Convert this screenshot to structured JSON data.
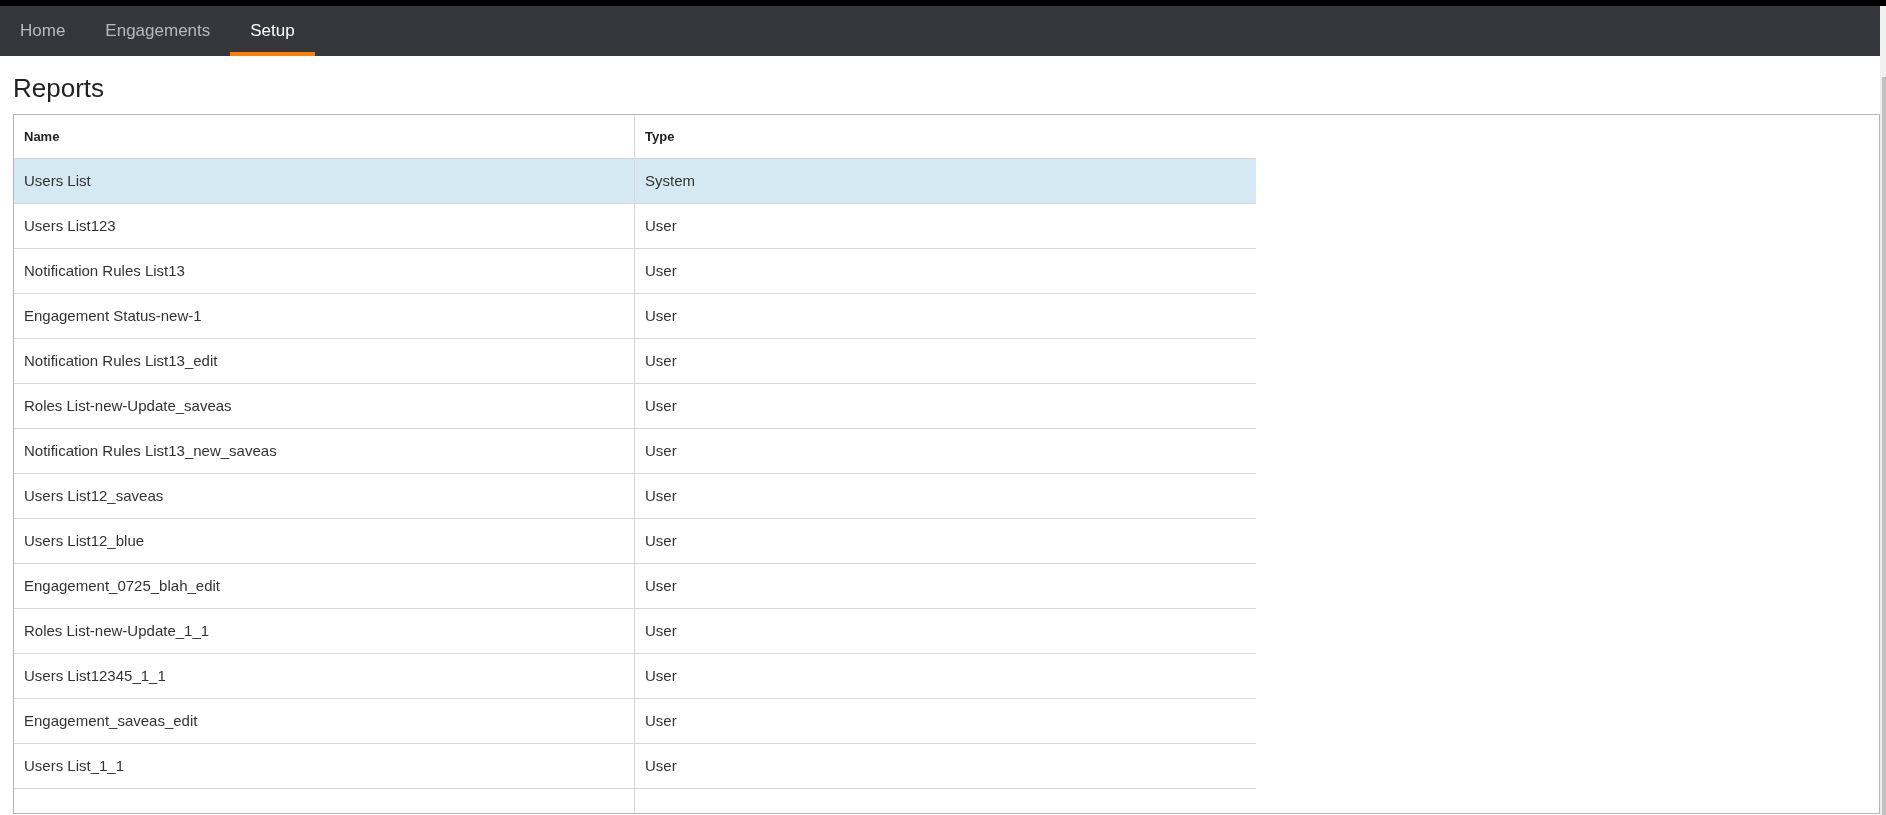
{
  "nav": {
    "tabs": [
      {
        "label": "Home",
        "selected": false
      },
      {
        "label": "Engagements",
        "selected": false
      },
      {
        "label": "Setup",
        "selected": true
      }
    ]
  },
  "page_title": "Reports",
  "table": {
    "columns": [
      "Name",
      "Type"
    ],
    "rows": [
      {
        "name": "Users List",
        "type": "System",
        "selected": true
      },
      {
        "name": "Users List123",
        "type": "User",
        "selected": false
      },
      {
        "name": "Notification Rules List13",
        "type": "User",
        "selected": false
      },
      {
        "name": "Engagement Status-new-1",
        "type": "User",
        "selected": false
      },
      {
        "name": "Notification Rules List13_edit",
        "type": "User",
        "selected": false
      },
      {
        "name": "Roles List-new-Update_saveas",
        "type": "User",
        "selected": false
      },
      {
        "name": "Notification Rules List13_new_saveas",
        "type": "User",
        "selected": false
      },
      {
        "name": "Users List12_saveas",
        "type": "User",
        "selected": false
      },
      {
        "name": "Users List12_blue",
        "type": "User",
        "selected": false
      },
      {
        "name": "Engagement_0725_blah_edit",
        "type": "User",
        "selected": false
      },
      {
        "name": "Roles List-new-Update_1_1",
        "type": "User",
        "selected": false
      },
      {
        "name": "Users List12345_1_1",
        "type": "User",
        "selected": false
      },
      {
        "name": "Engagement_saveas_edit",
        "type": "User",
        "selected": false
      },
      {
        "name": "Users List_1_1",
        "type": "User",
        "selected": false
      }
    ]
  }
}
